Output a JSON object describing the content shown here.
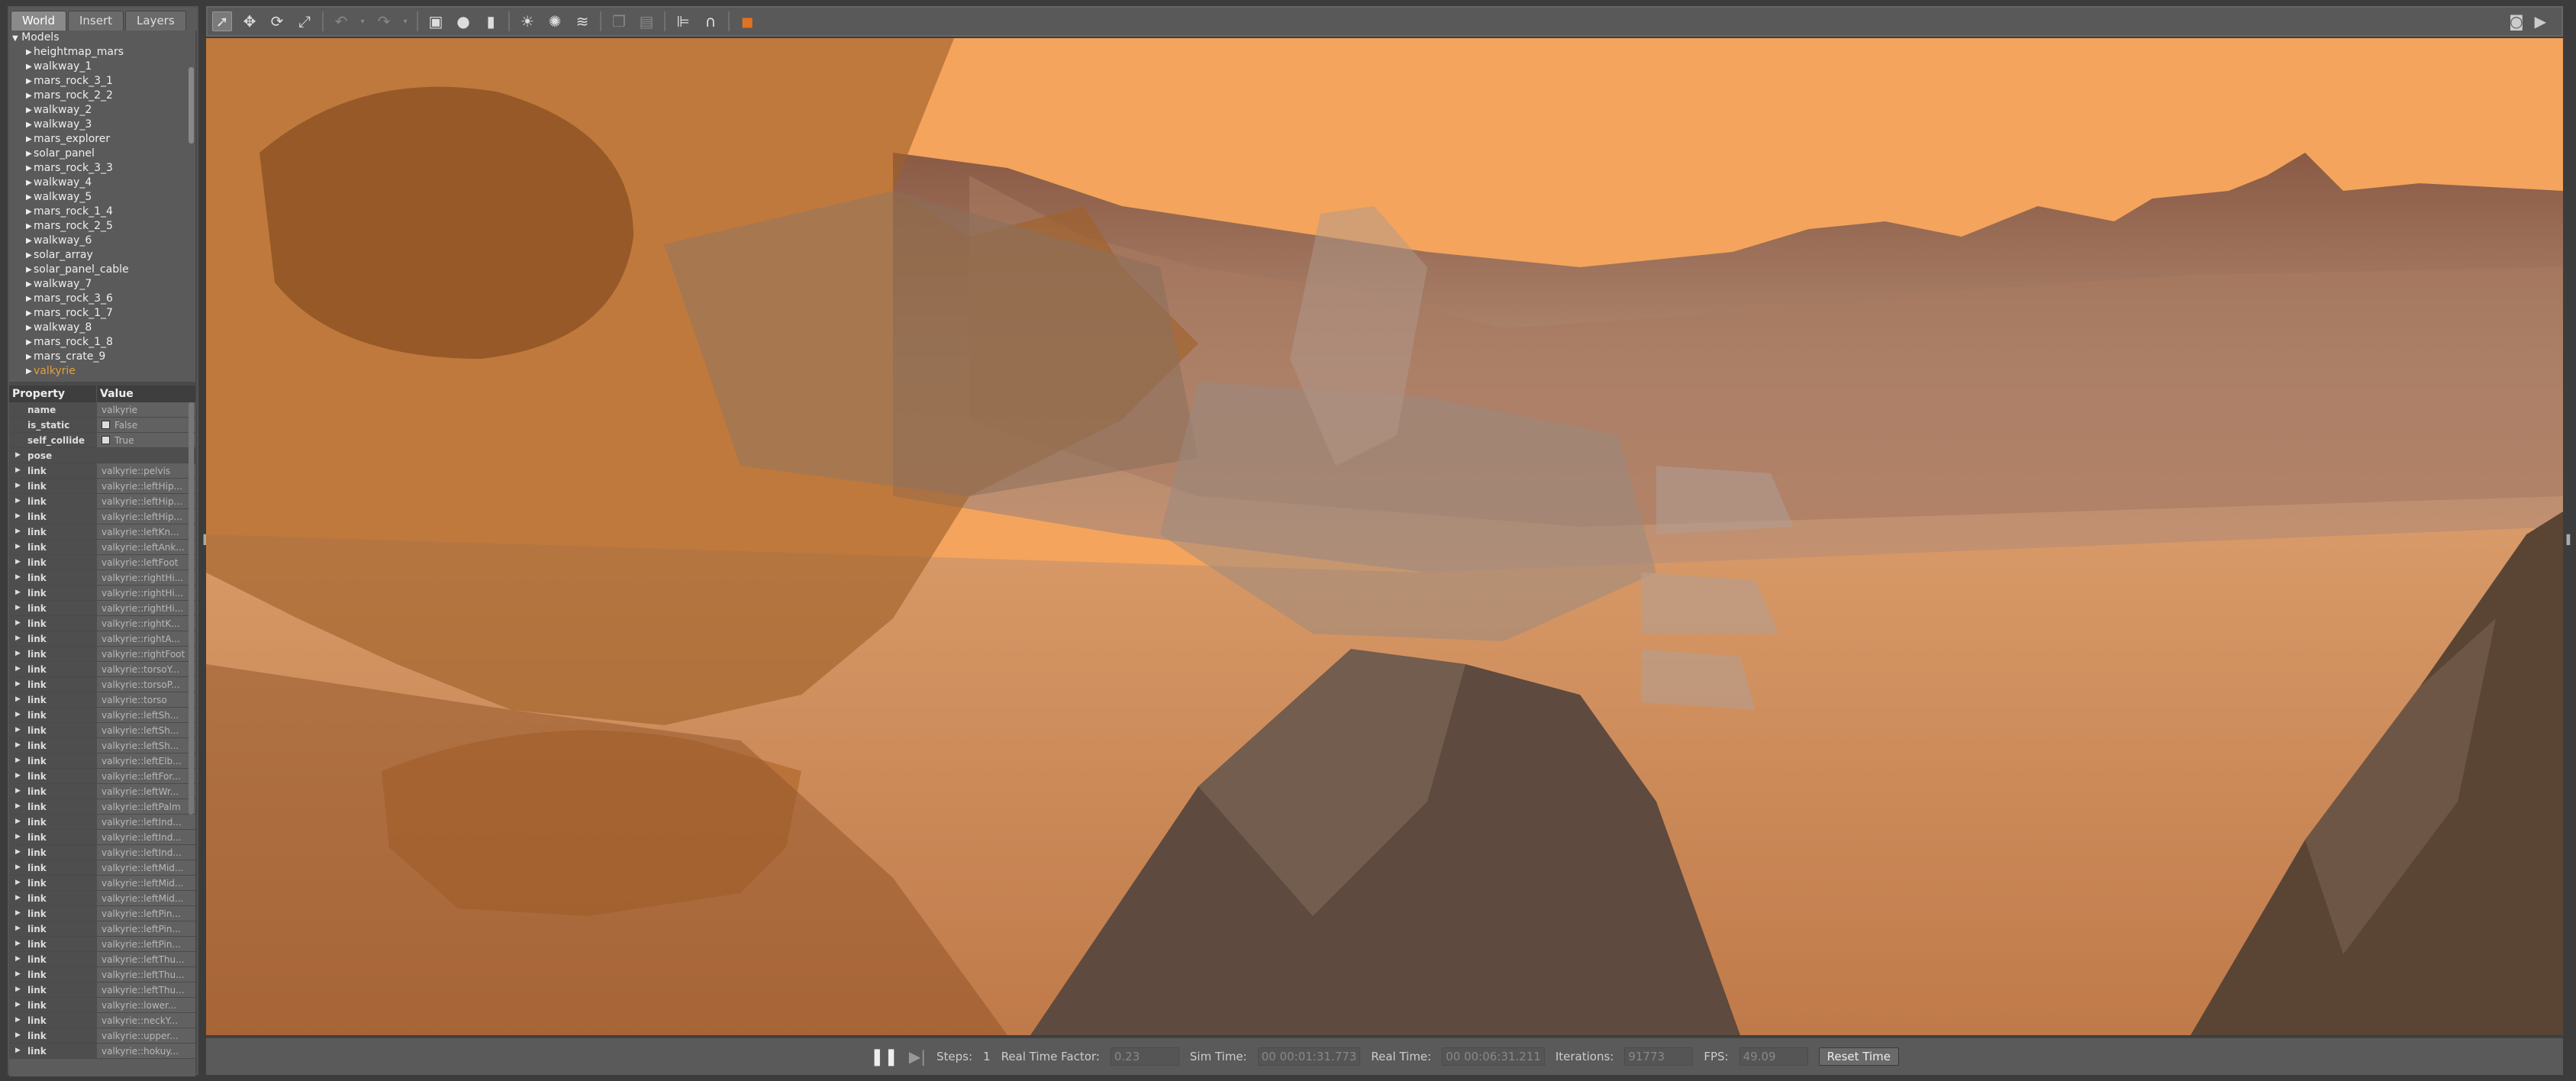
{
  "tabs": [
    "World",
    "Insert",
    "Layers"
  ],
  "tree": {
    "root": "Models",
    "items": [
      "heightmap_mars",
      "walkway_1",
      "mars_rock_3_1",
      "mars_rock_2_2",
      "walkway_2",
      "walkway_3",
      "mars_explorer",
      "solar_panel",
      "mars_rock_3_3",
      "walkway_4",
      "walkway_5",
      "mars_rock_1_4",
      "mars_rock_2_5",
      "walkway_6",
      "solar_array",
      "solar_panel_cable",
      "walkway_7",
      "mars_rock_3_6",
      "mars_rock_1_7",
      "walkway_8",
      "mars_rock_1_8",
      "mars_crate_9",
      "valkyrie"
    ]
  },
  "properties": {
    "header": {
      "property": "Property",
      "value": "Value"
    },
    "name": {
      "key": "name",
      "value": "valkyrie"
    },
    "is_static": {
      "key": "is_static",
      "value": "False"
    },
    "self_collide": {
      "key": "self_collide",
      "value": "True"
    },
    "pose": {
      "key": "pose"
    },
    "links": [
      "valkyrie::pelvis",
      "valkyrie::leftHip...",
      "valkyrie::leftHip...",
      "valkyrie::leftHip...",
      "valkyrie::leftKn...",
      "valkyrie::leftAnk...",
      "valkyrie::leftFoot",
      "valkyrie::rightHi...",
      "valkyrie::rightHi...",
      "valkyrie::rightHi...",
      "valkyrie::rightK...",
      "valkyrie::rightA...",
      "valkyrie::rightFoot",
      "valkyrie::torsoY...",
      "valkyrie::torsoP...",
      "valkyrie::torso",
      "valkyrie::leftSh...",
      "valkyrie::leftSh...",
      "valkyrie::leftSh...",
      "valkyrie::leftElb...",
      "valkyrie::leftFor...",
      "valkyrie::leftWr...",
      "valkyrie::leftPalm",
      "valkyrie::leftInd...",
      "valkyrie::leftInd...",
      "valkyrie::leftInd...",
      "valkyrie::leftMid...",
      "valkyrie::leftMid...",
      "valkyrie::leftMid...",
      "valkyrie::leftPin...",
      "valkyrie::leftPin...",
      "valkyrie::leftPin...",
      "valkyrie::leftThu...",
      "valkyrie::leftThu...",
      "valkyrie::leftThu...",
      "valkyrie::lower...",
      "valkyrie::neckY...",
      "valkyrie::upper...",
      "valkyrie::hokuy..."
    ],
    "link_key": "link"
  },
  "toolbar": {
    "icons": [
      "select-icon",
      "translate-icon",
      "rotate-icon",
      "scale-icon",
      "undo-icon",
      "undo-dropdown-icon",
      "redo-icon",
      "redo-dropdown-icon",
      "box-icon",
      "sphere-icon",
      "cylinder-icon",
      "sun-light-icon",
      "point-light-icon",
      "spot-light-icon",
      "copy-icon",
      "paste-icon",
      "align-icon",
      "snap-icon",
      "color-icon"
    ],
    "right_icons": [
      "camera-icon",
      "video-icon"
    ]
  },
  "status": {
    "steps_label": "Steps:",
    "steps_value": "1",
    "rtf_label": "Real Time Factor:",
    "rtf_value": "0.23",
    "sim_label": "Sim Time:",
    "sim_value": "00 00:01:31.773",
    "real_label": "Real Time:",
    "real_value": "00 00:06:31.211",
    "iter_label": "Iterations:",
    "iter_value": "91773",
    "fps_label": "FPS:",
    "fps_value": "49.09",
    "reset_label": "Reset Time"
  },
  "colors": {
    "sky": "#f4a45c",
    "ground": "#c98a5c",
    "robot": "#a0622a",
    "rock": "#5e4a3e"
  }
}
